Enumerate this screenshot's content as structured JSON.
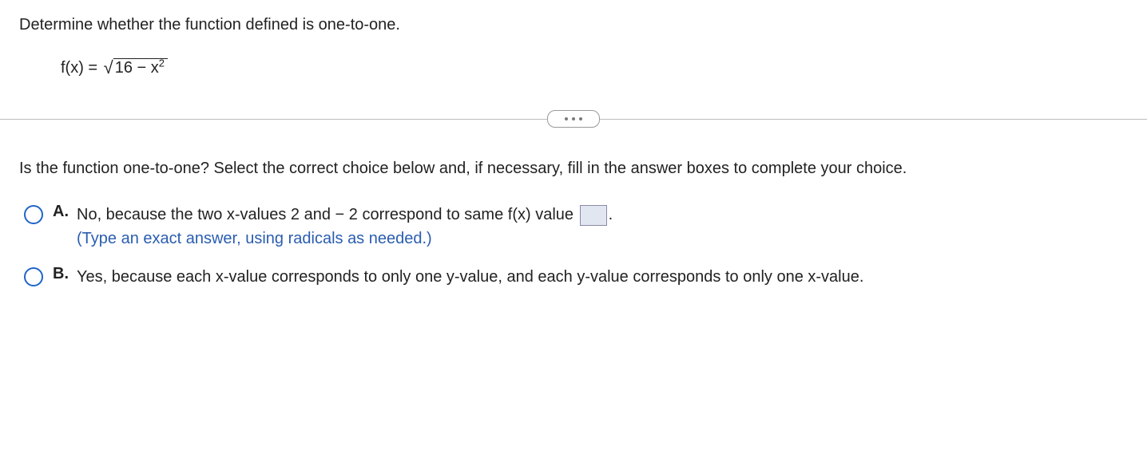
{
  "question": {
    "prompt": "Determine whether the function defined is one-to-one.",
    "formula": {
      "lhs": "f(x) = ",
      "radicand_prefix": "16 − x",
      "radicand_exponent": "2"
    }
  },
  "subquestion": "Is the function one-to-one? Select the correct choice below and, if necessary, fill in the answer boxes to complete your choice.",
  "choices": {
    "a": {
      "letter": "A.",
      "text_before_box": "No, because the two x-values 2 and  − 2 correspond to same f(x) value ",
      "text_after_box": ".",
      "hint": "(Type an exact answer, using radicals as needed.)"
    },
    "b": {
      "letter": "B.",
      "text": "Yes, because each x-value corresponds to only one y-value, and each y-value corresponds to only one x-value."
    }
  }
}
